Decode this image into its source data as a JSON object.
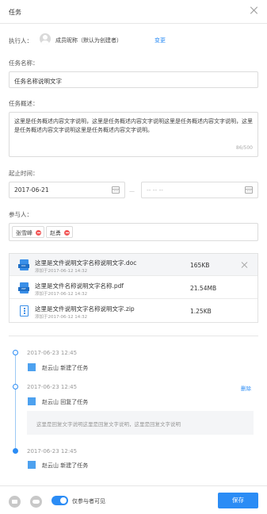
{
  "header": {
    "title": "任务"
  },
  "owner": {
    "label": "执行人：",
    "name": "成员昵称（默认为创建者）",
    "change_label": "变更"
  },
  "task_name": {
    "label": "任务名称：",
    "value": "任务名称说明文字"
  },
  "description": {
    "label": "任务概述：",
    "value": "这里是任务概述内容文字说明，这里是任务概述内容文字说明这里是任务概述内容文字说明，这里是任务概述内容文字说明这里是任务概述内容文字说明。",
    "count": "86/500"
  },
  "time": {
    "label": "起止时间：",
    "start": "2017-06-21",
    "separator": "—",
    "end_placeholder": "-- -- --"
  },
  "participants": {
    "label": "参与人：",
    "chips": [
      "张雪峰",
      "赵勇"
    ]
  },
  "files": [
    {
      "name": "这里是文件说明文字名称说明文字.doc",
      "date": "添加于2017-06-12 14:32",
      "size": "165KB",
      "type": "DOC"
    },
    {
      "name": "这里是文件名称说明文字名称.pdf",
      "date": "添加于2017-06-12 14:32",
      "size": "21.54MB",
      "type": "PDF"
    },
    {
      "name": "这里是文件说明文字名称说明文字.zip",
      "date": "添加于2017-06-12 14:32",
      "size": "1.25KB",
      "type": "ZIP"
    }
  ],
  "timeline": [
    {
      "time": "2017-06-23 12:45",
      "action": "赵云山 新建了任务"
    },
    {
      "time": "2017-06-23 12:45",
      "action": "赵云山 回复了任务",
      "delete_label": "删除",
      "reply": "这里是回复文字说明这里是回复文字说明，这里是回复文字说明"
    },
    {
      "time": "2017-06-23 12:45",
      "action": "赵云山 新建了任务"
    }
  ],
  "footer": {
    "toggle_label": "仅参与者可见",
    "save_label": "保存"
  },
  "colors": {
    "accent": "#2b8cf5",
    "danger": "#f25a5a"
  }
}
